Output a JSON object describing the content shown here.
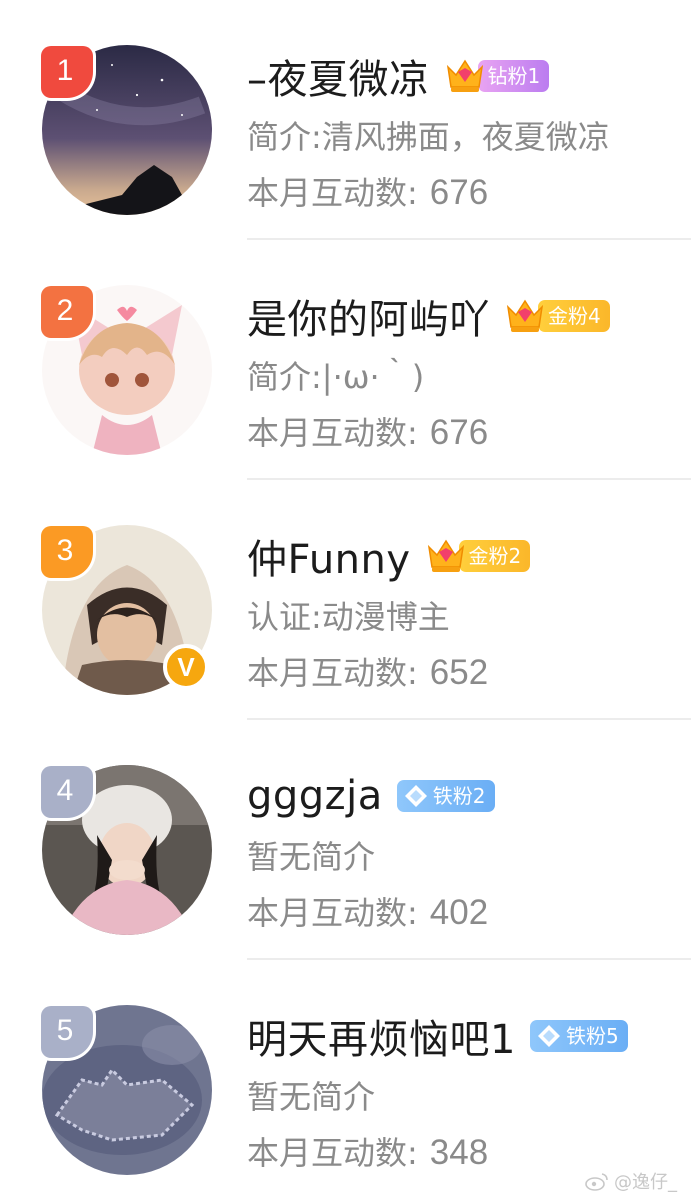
{
  "list": {
    "items": [
      {
        "rank": "1",
        "rank_color": "#f04a3e",
        "name": "–夜夏微凉",
        "badge_level": "7",
        "badge_label": "钻粉1",
        "badge_type": "diamond",
        "desc": "简介:清风拂面，夜夏微凉",
        "stat_label": "本月互动数:",
        "stat_value": "676",
        "verified": false
      },
      {
        "rank": "2",
        "rank_color": "#f37241",
        "name": "是你的阿屿吖",
        "badge_level": "6",
        "badge_label": "金粉4",
        "badge_type": "gold",
        "desc": "简介:|·ω·｀)",
        "stat_label": "本月互动数:",
        "stat_value": "676",
        "verified": false
      },
      {
        "rank": "3",
        "rank_color": "#fb9a24",
        "name": "仲Funny",
        "badge_level": "6",
        "badge_label": "金粉2",
        "badge_type": "gold",
        "desc": "认证:动漫博主",
        "stat_label": "本月互动数:",
        "stat_value": "652",
        "verified": true,
        "verified_label": "V"
      },
      {
        "rank": "4",
        "rank_color": "#a9b0c8",
        "name": "gggzja",
        "badge_level": "",
        "badge_label": "铁粉2",
        "badge_type": "iron",
        "desc": "暂无简介",
        "stat_label": "本月互动数:",
        "stat_value": "402",
        "verified": false
      },
      {
        "rank": "5",
        "rank_color": "#a9b0c8",
        "name": "明天再烦恼吧1",
        "badge_level": "",
        "badge_label": "铁粉5",
        "badge_type": "iron",
        "desc": "暂无简介",
        "stat_label": "本月互动数:",
        "stat_value": "348",
        "verified": false
      }
    ]
  },
  "watermark": {
    "text": "@逸仔_"
  }
}
